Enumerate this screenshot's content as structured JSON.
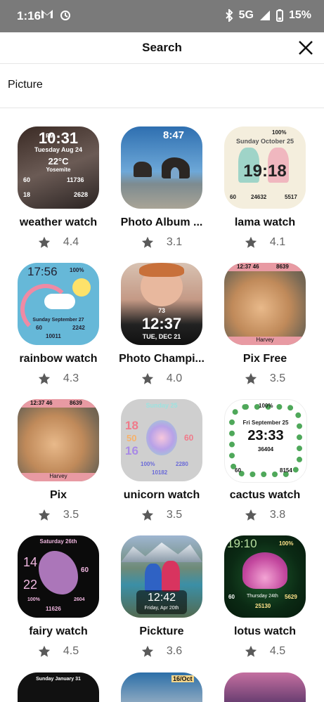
{
  "status": {
    "time": "1:16",
    "network": "5G",
    "battery": "15%"
  },
  "header": {
    "title": "Search"
  },
  "search": {
    "query": "Picture"
  },
  "tiles": [
    {
      "name": "weather watch",
      "rating": "4.4",
      "face": {
        "time": "10:31",
        "ampm": "PM",
        "date": "Tuesday Aug 24",
        "temp": "22°C",
        "place": "Yosemite",
        "l1": "60",
        "r1": "11736",
        "l2": "18",
        "r2": "2628"
      }
    },
    {
      "name": "Photo Album ...",
      "rating": "3.1",
      "face": {
        "time": "8:47"
      }
    },
    {
      "name": "lama watch",
      "rating": "4.1",
      "face": {
        "date": "Sunday October 25",
        "time": "19:18",
        "battery": "100%",
        "l1": "60",
        "m1": "24632",
        "r1": "5517"
      }
    },
    {
      "name": "rainbow watch",
      "rating": "4.3",
      "face": {
        "time": "17:56",
        "battery": "100%",
        "date": "Sunday September 27",
        "l1": "60",
        "r1": "2242",
        "b1": "10011"
      }
    },
    {
      "name": "Photo Champi...",
      "rating": "4.0",
      "face": {
        "hr": "73",
        "time": "12:37",
        "date": "TUE, DEC 21"
      }
    },
    {
      "name": "Pix Free",
      "rating": "3.5",
      "face": {
        "top": "12:37 46",
        "steps": "8639",
        "caption": "Harvey"
      }
    },
    {
      "name": "Pix",
      "rating": "3.5",
      "face": {
        "top": "12:37 46",
        "steps": "8639",
        "caption": "Harvey"
      }
    },
    {
      "name": "unicorn watch",
      "rating": "3.5",
      "face": {
        "date": "Sunday 25",
        "h": "18",
        "m": "50",
        "s": "16",
        "hr": "60",
        "battery": "100%",
        "r1": "2280",
        "b1": "10182"
      }
    },
    {
      "name": "cactus watch",
      "rating": "3.8",
      "face": {
        "battery": "100%",
        "date": "Fri September 25",
        "time": "23:33",
        "steps": "36404",
        "l1": "60",
        "r1": "8154"
      }
    },
    {
      "name": "fairy watch",
      "rating": "4.5",
      "face": {
        "date": "Saturday 26th",
        "h": "14",
        "m": "22",
        "hr": "60",
        "battery": "100%",
        "r1": "2604",
        "b1": "11626"
      }
    },
    {
      "name": "Pickture",
      "rating": "3.6",
      "face": {
        "time": "12:42",
        "date": "Friday, Apr 20th"
      }
    },
    {
      "name": "lotus watch",
      "rating": "4.5",
      "face": {
        "time": "19:10",
        "battery": "100%",
        "date": "Thursday 24th",
        "l1": "60",
        "r1": "5629",
        "b1": "25130"
      }
    }
  ],
  "peek": [
    {
      "text": "Sunday January 31"
    },
    {
      "text": "16/Oct"
    },
    {
      "text": ""
    }
  ]
}
